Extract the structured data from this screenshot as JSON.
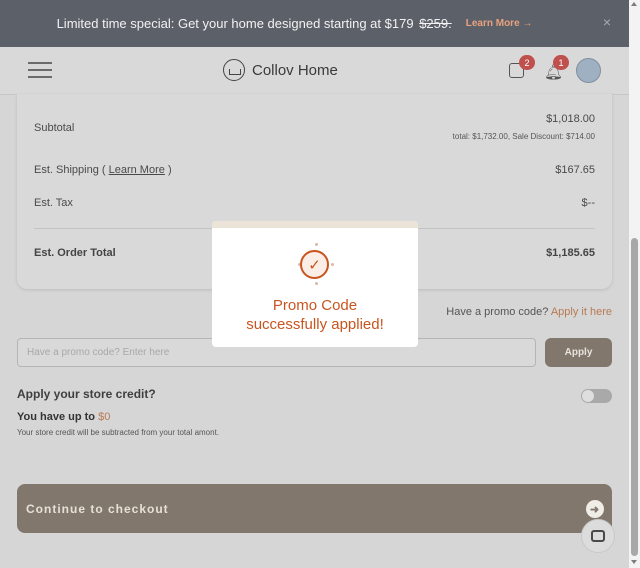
{
  "banner": {
    "text": "Limited time special: Get your home designed starting at $179",
    "old_price": "$259.",
    "learn_more": "Learn More →",
    "close": "×"
  },
  "header": {
    "brand": "Collov Home",
    "cart_count": "2",
    "notification_count": "1"
  },
  "summary": {
    "subtotal_label": "Subtotal",
    "subtotal_value": "$1,018.00",
    "subtotal_note": "total: $1,732.00, Sale Discount: $714.00",
    "shipping_label_pre": "Est. Shipping (",
    "shipping_link": "Learn More",
    "shipping_label_post": ")",
    "shipping_value": "$167.65",
    "tax_label": "Est. Tax",
    "tax_value": "$--",
    "total_label": "Est. Order Total",
    "total_value": "$1,185.65"
  },
  "promo": {
    "prompt": "Have a promo code?",
    "apply_link": "Apply it here",
    "placeholder": "Have a promo code? Enter here",
    "apply_button": "Apply"
  },
  "store_credit": {
    "title": "Apply your store credit?",
    "upto_label": "You have up to",
    "upto_amount": "$0",
    "note": "Your store credit will be subtracted from your total amont.",
    "enabled": false
  },
  "checkout": {
    "label": "Continue to checkout",
    "arrow": "➜"
  },
  "modal": {
    "line1": "Promo Code",
    "line2": "successfully applied!",
    "check": "✓"
  },
  "colors": {
    "accent": "#c8551f",
    "button": "#82776c",
    "banner_bg": "#5c6068",
    "badge": "#c0504d"
  }
}
